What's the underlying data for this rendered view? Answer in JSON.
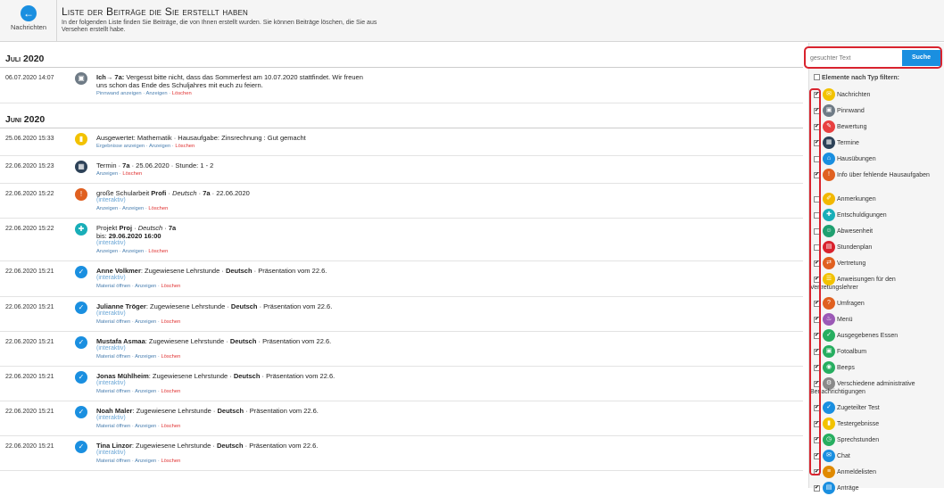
{
  "header": {
    "back_label": "Nachrichten",
    "title": "Liste der Beiträge die Sie erstellt haben",
    "description": "In der folgenden Liste finden Sie Beiträge, die von Ihnen erstellt wurden. Sie können Beiträge löschen, die Sie aus Versehen erstellt habe."
  },
  "search": {
    "placeholder": "gesuchter Text",
    "button": "Suche"
  },
  "filter": {
    "heading": "Elemente nach Typ filtern:",
    "items": [
      {
        "label": "Nachrichten",
        "checked": true,
        "color": "#f2c200",
        "glyph": "✉"
      },
      {
        "label": "Pinnwand",
        "checked": true,
        "color": "#6f7b86",
        "glyph": "▣"
      },
      {
        "label": "Bewertung",
        "checked": true,
        "color": "#e84040",
        "glyph": "✎"
      },
      {
        "label": "Termine",
        "checked": true,
        "color": "#2d4258",
        "glyph": "▦"
      },
      {
        "label": "Hausübungen",
        "checked": false,
        "color": "#1a8fe0",
        "glyph": "⌂"
      },
      {
        "label": "Info über fehlende Hausaufgaben",
        "checked": true,
        "color": "#e06020",
        "glyph": "!"
      },
      {
        "label": "Anmerkungen",
        "checked": false,
        "color": "#f2b800",
        "glyph": "✐"
      },
      {
        "label": "Entschuldigungen",
        "checked": false,
        "color": "#19aeb8",
        "glyph": "✚"
      },
      {
        "label": "Abwesenheit",
        "checked": false,
        "color": "#20a070",
        "glyph": "☺"
      },
      {
        "label": "Stundenplan",
        "checked": false,
        "color": "#d9232e",
        "glyph": "▤"
      },
      {
        "label": "Vertretung",
        "checked": true,
        "color": "#e06020",
        "glyph": "⇄"
      },
      {
        "label": "Anweisungen für den Vertretungslehrer",
        "checked": true,
        "color": "#f2c200",
        "glyph": "☰"
      },
      {
        "label": "Umfragen",
        "checked": true,
        "color": "#e06020",
        "glyph": "?"
      },
      {
        "label": "Menü",
        "checked": true,
        "color": "#9b59b6",
        "glyph": "♨"
      },
      {
        "label": "Ausgegebenes Essen",
        "checked": true,
        "color": "#27ae60",
        "glyph": "✓"
      },
      {
        "label": "Fotoalbum",
        "checked": true,
        "color": "#27ae60",
        "glyph": "▣"
      },
      {
        "label": "Beeps",
        "checked": true,
        "color": "#27ae60",
        "glyph": "◉"
      },
      {
        "label": "Verschiedene administrative Benachrichtigungen",
        "checked": true,
        "color": "#8a8a8a",
        "glyph": "⚙"
      },
      {
        "label": "Zugeteilter Test",
        "checked": true,
        "color": "#1a8fe0",
        "glyph": "✓"
      },
      {
        "label": "Testergebnisse",
        "checked": true,
        "color": "#f2c200",
        "glyph": "▮"
      },
      {
        "label": "Sprechstunden",
        "checked": true,
        "color": "#27ae60",
        "glyph": "◷"
      },
      {
        "label": "Chat",
        "checked": true,
        "color": "#1a8fe0",
        "glyph": "✉"
      },
      {
        "label": "Anmeldelisten",
        "checked": true,
        "color": "#e08a00",
        "glyph": "≡"
      },
      {
        "label": "Anträge",
        "checked": true,
        "color": "#1a8fe0",
        "glyph": "▤"
      }
    ]
  },
  "months": [
    {
      "name": "Juli 2020",
      "rows": [
        {
          "date": "06.07.2020 14:07",
          "color": "#6f7b86",
          "glyph": "▣",
          "h": 40,
          "parts": [
            {
              "t": "Ich→ 7a:",
              "b": true
            },
            {
              "t": " Vergesst bitte nicht, dass das Sommerfest am 10.07.2020 stattfindet. Wir freuen uns schon das Ende des Schuljahres mit euch zu feiern."
            }
          ],
          "interactive": "",
          "actions": [
            "Pinnwand anzeigen",
            "Anzeigen",
            "Löschen"
          ]
        }
      ]
    },
    {
      "name": "Juni 2020",
      "rows": [
        {
          "date": "25.06.2020 15:33",
          "color": "#f2c200",
          "glyph": "▮",
          "h": 31,
          "parts": [
            {
              "t": "Ausgewertet: Mathematik · Hausaufgabe: Zinsrechnung : Gut gemacht"
            }
          ],
          "interactive": "",
          "actions": [
            "Ergebnisse anzeigen",
            "Anzeigen",
            "Löschen"
          ]
        },
        {
          "date": "22.06.2020 15:23",
          "color": "#2d4258",
          "glyph": "▦",
          "h": 31,
          "parts": [
            {
              "t": "Termin · "
            },
            {
              "t": "7a",
              "b": true
            },
            {
              "t": " · 25.06.2020 · Stunde: 1 - 2"
            }
          ],
          "interactive": "",
          "actions": [
            "Anzeigen",
            "Löschen"
          ]
        },
        {
          "date": "22.06.2020 15:22",
          "color": "#e06020",
          "glyph": "!",
          "h": 39,
          "parts": [
            {
              "t": "große Schularbeit "
            },
            {
              "t": "Profi",
              "b": true
            },
            {
              "t": " · "
            },
            {
              "t": "Deutsch",
              "i": true
            },
            {
              "t": " · "
            },
            {
              "t": "7a",
              "b": true
            },
            {
              "t": " · 22.06.2020"
            }
          ],
          "interactive": "(interaktiv)",
          "actions": [
            "Anzeigen",
            "Anzeigen",
            "Löschen"
          ]
        },
        {
          "date": "22.06.2020 15:22",
          "color": "#19aeb8",
          "glyph": "✚",
          "h": 48,
          "parts": [
            {
              "t": "Projekt "
            },
            {
              "t": "Proj",
              "b": true
            },
            {
              "t": " · "
            },
            {
              "t": "Deutsch",
              "i": true
            },
            {
              "t": " · "
            },
            {
              "t": "7a",
              "b": true
            },
            {
              "t": "\nbis: "
            },
            {
              "t": "29.06.2020 16:00",
              "b": true
            }
          ],
          "interactive": "(interaktiv)",
          "actions": [
            "Anzeigen",
            "Anzeigen",
            "Löschen"
          ]
        },
        {
          "date": "22.06.2020 15:21",
          "color": "#1a8fe0",
          "glyph": "✓",
          "h": 40,
          "parts": [
            {
              "t": "Anne Volkmer",
              "b": true
            },
            {
              "t": ": Zugewiesene Lehrstunde · "
            },
            {
              "t": "Deutsch",
              "b": true
            },
            {
              "t": " · Präsentation vom 22.6."
            }
          ],
          "interactive": "(interaktiv)",
          "actions": [
            "Material öffnen",
            "Anzeigen",
            "Löschen"
          ]
        },
        {
          "date": "22.06.2020 15:21",
          "color": "#1a8fe0",
          "glyph": "✓",
          "h": 39,
          "parts": [
            {
              "t": "Julianne Tröger",
              "b": true
            },
            {
              "t": ": Zugewiesene Lehrstunde · "
            },
            {
              "t": "Deutsch",
              "b": true
            },
            {
              "t": " · Präsentation vom 22.6."
            }
          ],
          "interactive": "(interaktiv)",
          "actions": [
            "Material öffnen",
            "Anzeigen",
            "Löschen"
          ]
        },
        {
          "date": "22.06.2020 15:21",
          "color": "#1a8fe0",
          "glyph": "✓",
          "h": 39,
          "parts": [
            {
              "t": "Mustafa Asmaa",
              "b": true
            },
            {
              "t": ": Zugewiesene Lehrstunde · "
            },
            {
              "t": "Deutsch",
              "b": true
            },
            {
              "t": " · Präsentation vom 22.6."
            }
          ],
          "interactive": "(interaktiv)",
          "actions": [
            "Material öffnen",
            "Anzeigen",
            "Löschen"
          ]
        },
        {
          "date": "22.06.2020 15:21",
          "color": "#1a8fe0",
          "glyph": "✓",
          "h": 39,
          "parts": [
            {
              "t": "Jonas Mühlheim",
              "b": true
            },
            {
              "t": ": Zugewiesene Lehrstunde · "
            },
            {
              "t": "Deutsch",
              "b": true
            },
            {
              "t": " · Präsentation vom 22.6."
            }
          ],
          "interactive": "(interaktiv)",
          "actions": [
            "Material öffnen",
            "Anzeigen",
            "Löschen"
          ]
        },
        {
          "date": "22.06.2020 15:21",
          "color": "#1a8fe0",
          "glyph": "✓",
          "h": 39,
          "parts": [
            {
              "t": "Noah Maler",
              "b": true
            },
            {
              "t": ": Zugewiesene Lehrstunde · "
            },
            {
              "t": "Deutsch",
              "b": true
            },
            {
              "t": " · Präsentation vom 22.6."
            }
          ],
          "interactive": "(interaktiv)",
          "actions": [
            "Material öffnen",
            "Anzeigen",
            "Löschen"
          ]
        },
        {
          "date": "22.06.2020 15:21",
          "color": "#1a8fe0",
          "glyph": "✓",
          "h": 39,
          "parts": [
            {
              "t": "Tina Linzor",
              "b": true
            },
            {
              "t": ": Zugewiesene Lehrstunde · "
            },
            {
              "t": "Deutsch",
              "b": true
            },
            {
              "t": " · Präsentation vom 22.6."
            }
          ],
          "interactive": "(interaktiv)",
          "actions": [
            "Material öffnen",
            "Anzeigen",
            "Löschen"
          ]
        }
      ]
    }
  ]
}
